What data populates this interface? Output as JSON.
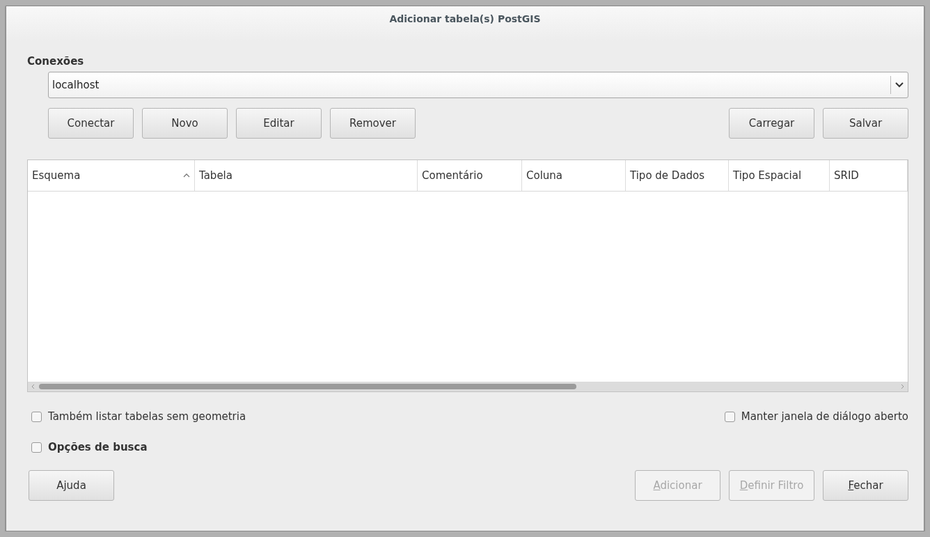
{
  "window": {
    "title": "Adicionar tabela(s) PostGIS"
  },
  "connections": {
    "label": "Conexões",
    "value": "localhost"
  },
  "connection_buttons": {
    "left": [
      "Conectar",
      "Novo",
      "Editar",
      "Remover"
    ],
    "right": [
      "Carregar",
      "Salvar"
    ]
  },
  "table": {
    "columns": [
      {
        "label": "Esquema",
        "sorted": true
      },
      {
        "label": "Tabela",
        "sorted": false
      },
      {
        "label": "Comentário",
        "sorted": false
      },
      {
        "label": "Coluna",
        "sorted": false
      },
      {
        "label": "Tipo de Dados",
        "sorted": false
      },
      {
        "label": "Tipo Espacial",
        "sorted": false
      },
      {
        "label": "SRID",
        "sorted": false
      }
    ]
  },
  "options": [
    {
      "label": "Também listar tabelas sem geometria",
      "checked": false
    },
    {
      "label": "Manter janela de diálogo aberto",
      "checked": false
    }
  ],
  "search_options": {
    "label": "Opções de busca",
    "checked": false
  },
  "footer_buttons": {
    "left": [
      {
        "rest": "Ajuda",
        "disabled": false
      }
    ],
    "right": [
      {
        "key": "A",
        "rest": "dicionar",
        "disabled": true
      },
      {
        "key": "D",
        "rest": "efinir Filtro",
        "disabled": true
      },
      {
        "key": "F",
        "rest": "echar",
        "disabled": false
      }
    ]
  }
}
